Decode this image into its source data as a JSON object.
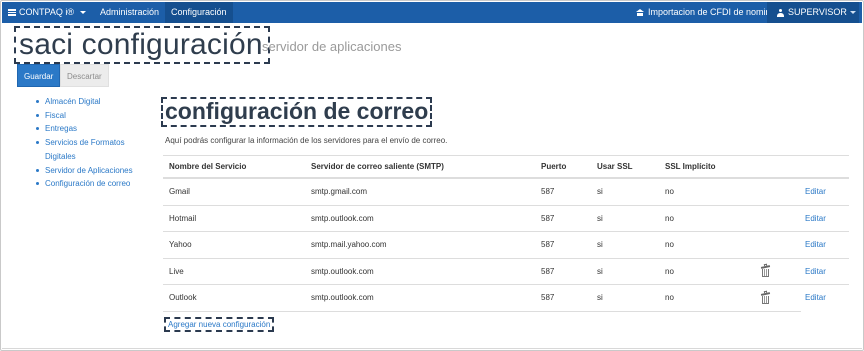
{
  "navbar": {
    "brand": "CONTPAQ i®",
    "items": [
      "Administración",
      "Configuración"
    ],
    "import_label": "Importacion de CFDI de nomina",
    "user_label": "SUPERVISOR"
  },
  "page": {
    "title": "saci configuración",
    "subtitle": "servidor de aplicaciones"
  },
  "actions": {
    "save_label": "Guardar",
    "discard_label": "Descartar"
  },
  "sidebar": {
    "items": [
      "Almacén Digital",
      "Fiscal",
      "Entregas",
      "Servicios de Formatos Digitales",
      "Servidor de Aplicaciones",
      "Configuración de correo"
    ]
  },
  "section": {
    "title": "configuración de correo",
    "description": "Aquí podrás configurar la información de los servidores para el envío de correo."
  },
  "table": {
    "headers": [
      "Nombre del Servicio",
      "Servidor de correo saliente (SMTP)",
      "Puerto",
      "Usar SSL",
      "SSL Implícito"
    ],
    "rows": [
      {
        "name": "Gmail",
        "smtp": "smtp.gmail.com",
        "port": "587",
        "ssl": "si",
        "implicit": "no",
        "delete": false,
        "action": "Editar"
      },
      {
        "name": "Hotmail",
        "smtp": "smtp.outlook.com",
        "port": "587",
        "ssl": "si",
        "implicit": "no",
        "delete": false,
        "action": "Editar"
      },
      {
        "name": "Yahoo",
        "smtp": "smtp.mail.yahoo.com",
        "port": "587",
        "ssl": "si",
        "implicit": "no",
        "delete": false,
        "action": "Editar"
      },
      {
        "name": "Live",
        "smtp": "smtp.outlook.com",
        "port": "587",
        "ssl": "si",
        "implicit": "no",
        "delete": true,
        "action": "Editar"
      },
      {
        "name": "Outlook",
        "smtp": "smtp.outlook.com",
        "port": "587",
        "ssl": "si",
        "implicit": "no",
        "delete": true,
        "action": "Editar"
      }
    ]
  },
  "add_config_label": "Agregar nueva configuración",
  "colors": {
    "navbar": "#1c5ea8",
    "accent": "#2b79c7",
    "title_text": "#2f3d4d"
  }
}
